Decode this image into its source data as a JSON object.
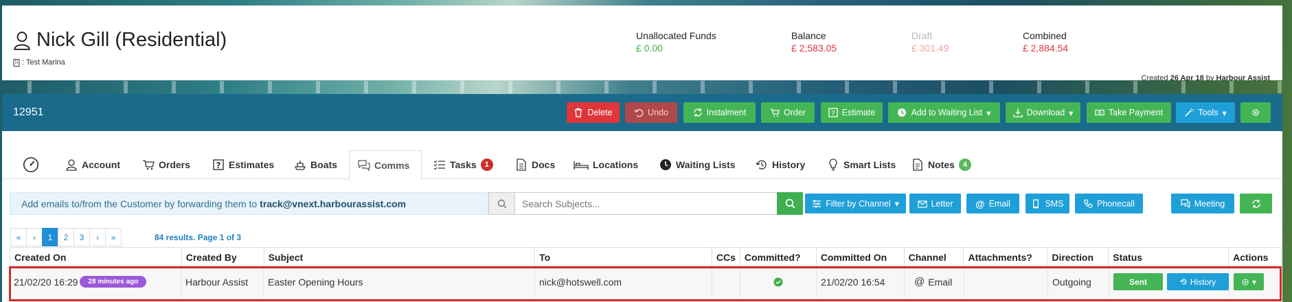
{
  "customer": {
    "name": "Nick Gill (Residential)",
    "marina_prefix": ": Test Marina"
  },
  "financials": {
    "unallocated_label": "Unallocated Funds",
    "unallocated_value": "£ 0.00",
    "balance_label": "Balance",
    "balance_value": "£ 2,583.05",
    "draft_label": "Draft",
    "draft_value": "£ 301.49",
    "combined_label": "Combined",
    "combined_value": "£ 2,884.54",
    "colors": {
      "positive": "#3fae49",
      "negative": "#e0363b",
      "draft_label": "#b9b9b9",
      "draft_value": "#f2a3a3"
    }
  },
  "created": {
    "prefix": "Created",
    "date": "26 Apr 18",
    "by_word": "by",
    "by": "Harbour Assist"
  },
  "toolbar": {
    "record_id": "12951",
    "delete": "Delete",
    "undo": "Undo",
    "instalment": "Instalment",
    "order": "Order",
    "estimate": "Estimate",
    "waiting_list": "Add to Waiting List",
    "download": "Download",
    "take_payment": "Take Payment",
    "tools": "Tools"
  },
  "tabs": {
    "account": "Account",
    "orders": "Orders",
    "estimates": "Estimates",
    "boats": "Boats",
    "comms": "Comms",
    "tasks": "Tasks",
    "tasks_count": "1",
    "docs": "Docs",
    "locations": "Locations",
    "waiting_lists": "Waiting Lists",
    "history": "History",
    "smart_lists": "Smart Lists",
    "notes": "Notes",
    "notes_count": "4"
  },
  "comms": {
    "info_text": "Add emails to/from the Customer by forwarding them to",
    "info_email": "track@vnext.harbourassist.com",
    "search_placeholder": "Search Subjects...",
    "filter_channel": "Filter by Channel",
    "letter": "Letter",
    "email": "Email",
    "sms": "SMS",
    "phonecall": "Phonecall",
    "meeting": "Meeting"
  },
  "pagination": {
    "first": "«",
    "prev": "‹",
    "pages": [
      "1",
      "2",
      "3"
    ],
    "next": "›",
    "last": "»",
    "summary": "84 results. Page 1 of 3"
  },
  "table": {
    "headers": [
      "Created On",
      "Created By",
      "Subject",
      "To",
      "CCs",
      "Committed?",
      "Committed On",
      "Channel",
      "Attachments?",
      "Direction",
      "Status",
      "Actions"
    ],
    "row": {
      "created_on": "21/02/20 16:29",
      "ago": "28 minutes ago",
      "created_by": "Harbour Assist",
      "subject": "Easter Opening Hours",
      "to": "nick@hotswell.com",
      "ccs": "",
      "committed_on": "21/02/20 16:54",
      "channel": "Email",
      "attachments": "",
      "direction": "Outgoing",
      "status": "Sent",
      "history": "History"
    }
  }
}
